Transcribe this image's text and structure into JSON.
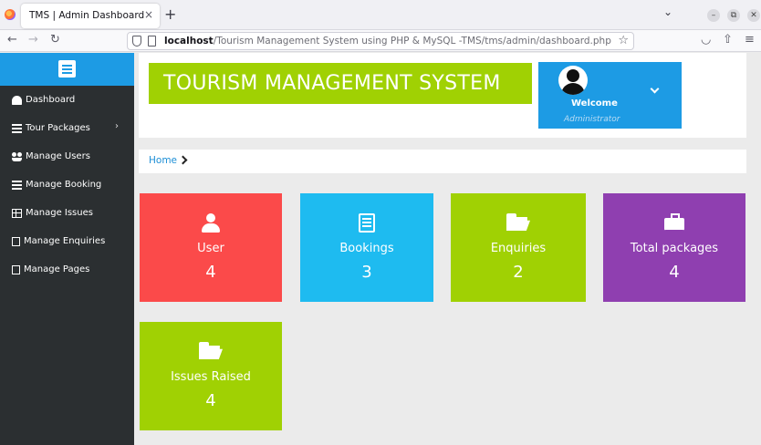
{
  "browser": {
    "tab_title": "TMS | Admin Dashboard",
    "tab_close": "×",
    "new_tab": "+",
    "url_host": "localhost",
    "url_path": "/Tourism Management System using PHP & MySQL -TMS/tms/admin/dashboard.php"
  },
  "sidebar": {
    "items": [
      {
        "label": "Dashboard",
        "icon": "dashboard-icon"
      },
      {
        "label": "Tour Packages",
        "icon": "list-icon",
        "has_submenu": true
      },
      {
        "label": "Manage Users",
        "icon": "users-icon"
      },
      {
        "label": "Manage Booking",
        "icon": "list-icon"
      },
      {
        "label": "Manage Issues",
        "icon": "table-icon"
      },
      {
        "label": "Manage Enquiries",
        "icon": "file-icon"
      },
      {
        "label": "Manage Pages",
        "icon": "file-icon"
      }
    ]
  },
  "header": {
    "title": "TOURISM MANAGEMENT SYSTEM",
    "welcome": "Welcome",
    "role": "Administrator"
  },
  "breadcrumb": {
    "home": "Home"
  },
  "cards": [
    {
      "label": "User",
      "value": "4",
      "icon": "user-icon",
      "color": "#fb4a4a"
    },
    {
      "label": "Bookings",
      "value": "3",
      "icon": "list-alt-icon",
      "color": "#1ebbf0"
    },
    {
      "label": "Enquiries",
      "value": "2",
      "icon": "folder-open-icon",
      "color": "#a0d103"
    },
    {
      "label": "Total packages",
      "value": "4",
      "icon": "briefcase-icon",
      "color": "#8f3fb0"
    },
    {
      "label": "Issues Raised",
      "value": "4",
      "icon": "folder-open-icon",
      "color": "#a0d103"
    }
  ],
  "colors": {
    "accent": "#1d9be4",
    "sidebar_bg": "#2b2f31",
    "brand_bg": "#a0d103"
  }
}
